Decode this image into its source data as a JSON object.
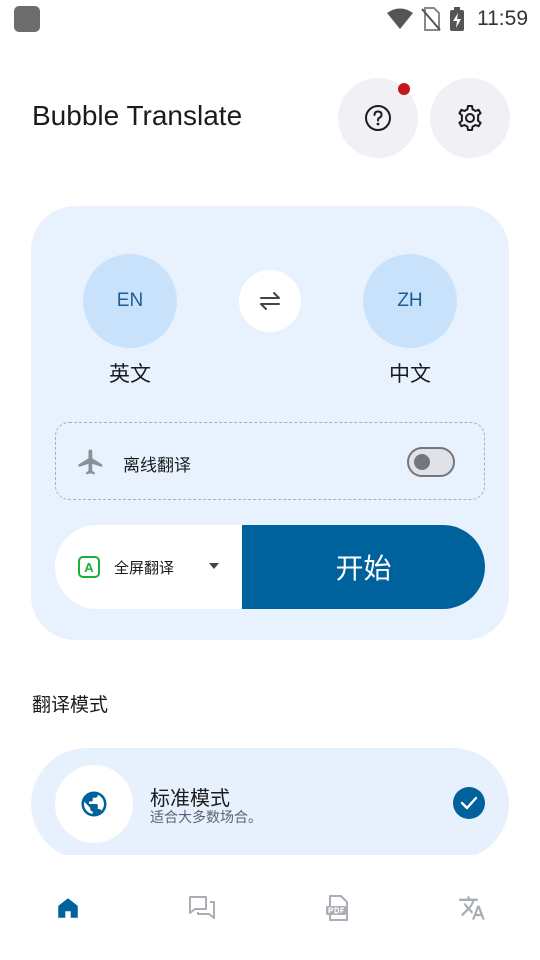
{
  "status_bar": {
    "time": "11:59",
    "icons": [
      "app-notification-icon",
      "wifi-icon",
      "no-sim-icon",
      "battery-charging-icon"
    ]
  },
  "header": {
    "title": "Bubble Translate",
    "help_icon": "help-circle-icon",
    "settings_icon": "gear-icon",
    "has_notification": true
  },
  "language": {
    "source_code": "EN",
    "source_name": "英文",
    "target_code": "ZH",
    "target_name": "中文",
    "swap_icon": "swap-horizontal-icon"
  },
  "offline": {
    "icon": "airplane-icon",
    "label": "离线翻译",
    "enabled": false
  },
  "action": {
    "mode_icon_letter": "A",
    "mode_label": "全屏翻译",
    "start_label": "开始"
  },
  "modes_section": {
    "title": "翻译模式",
    "selected": {
      "icon": "globe-icon",
      "title": "标准模式",
      "description": "适合大多数场合。",
      "checked": true
    }
  },
  "bottom_nav": {
    "items": [
      {
        "icon": "home-icon",
        "active": true
      },
      {
        "icon": "chat-icon",
        "active": false
      },
      {
        "icon": "pdf-icon",
        "active": false
      },
      {
        "icon": "translate-icon",
        "active": false
      }
    ]
  },
  "colors": {
    "primary": "#00629d",
    "card_bg": "#e7f2fe",
    "lang_circle": "#c9e2fb",
    "notification_dot": "#c4161c",
    "mode_badge": "#1fae3a"
  }
}
